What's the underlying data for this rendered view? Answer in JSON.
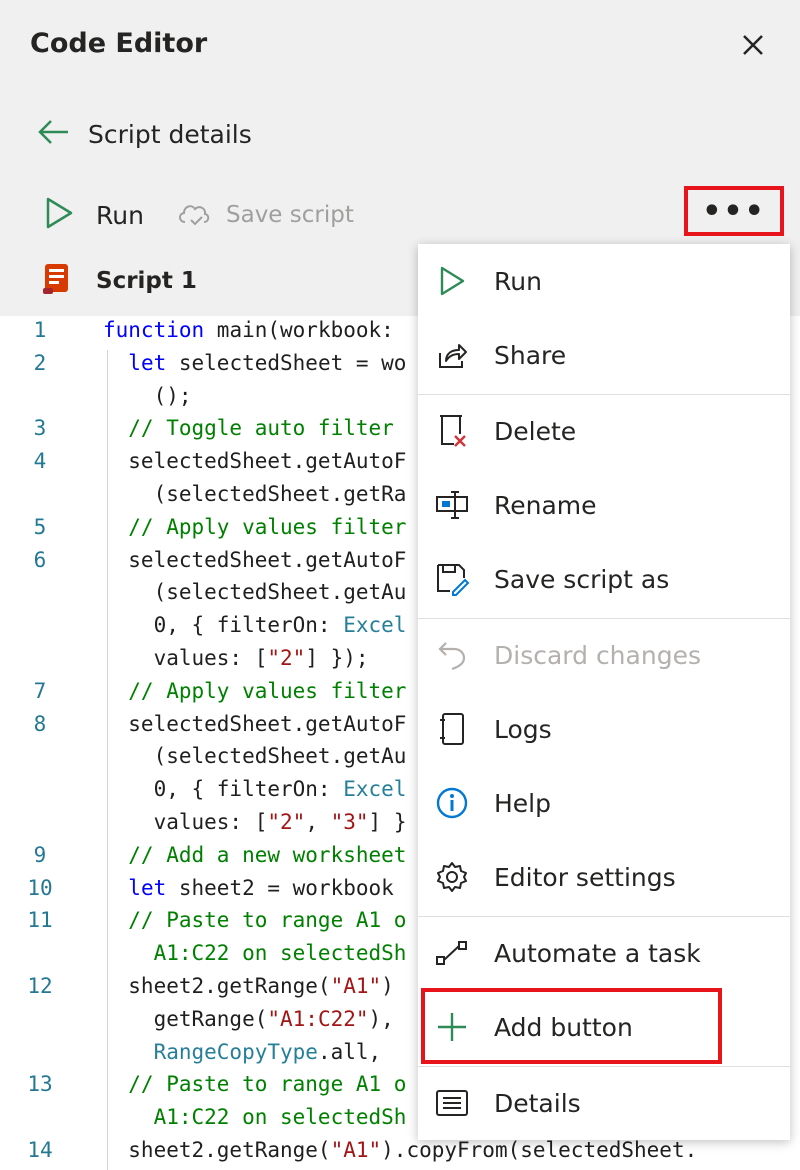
{
  "panel": {
    "title": "Code Editor"
  },
  "nav": {
    "back_label": "Script details"
  },
  "toolbar": {
    "run_label": "Run",
    "save_label": "Save script",
    "more_label": "•••"
  },
  "script": {
    "name": "Script 1"
  },
  "code_lines": [
    {
      "num": "1",
      "segments": [
        {
          "t": "function",
          "c": "kw"
        },
        {
          "t": " main(workbook:",
          "c": ""
        }
      ]
    },
    {
      "num": "2",
      "segments": [
        {
          "t": "  ",
          "c": ""
        },
        {
          "t": "let",
          "c": "kw"
        },
        {
          "t": " selectedSheet = wo",
          "c": ""
        }
      ]
    },
    {
      "num": "",
      "segments": [
        {
          "t": "    ();",
          "c": ""
        }
      ]
    },
    {
      "num": "3",
      "segments": [
        {
          "t": "  // Toggle auto filter",
          "c": "cm"
        }
      ]
    },
    {
      "num": "4",
      "segments": [
        {
          "t": "  selectedSheet.getAutoF",
          "c": ""
        }
      ]
    },
    {
      "num": "",
      "segments": [
        {
          "t": "    (selectedSheet.getRa",
          "c": ""
        }
      ]
    },
    {
      "num": "5",
      "segments": [
        {
          "t": "  // Apply values filter",
          "c": "cm"
        }
      ]
    },
    {
      "num": "6",
      "segments": [
        {
          "t": "  selectedSheet.getAutoF",
          "c": ""
        }
      ]
    },
    {
      "num": "",
      "segments": [
        {
          "t": "    (selectedSheet.getAu",
          "c": ""
        }
      ]
    },
    {
      "num": "",
      "segments": [
        {
          "t": "    0, { filterOn: ",
          "c": ""
        },
        {
          "t": "Excel",
          "c": "ty"
        }
      ]
    },
    {
      "num": "",
      "segments": [
        {
          "t": "    values: [",
          "c": ""
        },
        {
          "t": "\"2\"",
          "c": "st"
        },
        {
          "t": "] });",
          "c": ""
        }
      ]
    },
    {
      "num": "7",
      "segments": [
        {
          "t": "  // Apply values filter",
          "c": "cm"
        }
      ]
    },
    {
      "num": "8",
      "segments": [
        {
          "t": "  selectedSheet.getAutoF",
          "c": ""
        }
      ]
    },
    {
      "num": "",
      "segments": [
        {
          "t": "    (selectedSheet.getAu",
          "c": ""
        }
      ]
    },
    {
      "num": "",
      "segments": [
        {
          "t": "    0, { filterOn: ",
          "c": ""
        },
        {
          "t": "Excel",
          "c": "ty"
        }
      ]
    },
    {
      "num": "",
      "segments": [
        {
          "t": "    values: [",
          "c": ""
        },
        {
          "t": "\"2\"",
          "c": "st"
        },
        {
          "t": ", ",
          "c": ""
        },
        {
          "t": "\"3\"",
          "c": "st"
        },
        {
          "t": "] }",
          "c": ""
        }
      ]
    },
    {
      "num": "9",
      "segments": [
        {
          "t": "  // Add a new worksheet",
          "c": "cm"
        }
      ]
    },
    {
      "num": "10",
      "segments": [
        {
          "t": "  ",
          "c": ""
        },
        {
          "t": "let",
          "c": "kw"
        },
        {
          "t": " sheet2 = workbook",
          "c": ""
        }
      ]
    },
    {
      "num": "11",
      "segments": [
        {
          "t": "  // Paste to range A1 o",
          "c": "cm"
        }
      ]
    },
    {
      "num": "",
      "segments": [
        {
          "t": "    A1:C22 on selectedSh",
          "c": "cm"
        }
      ]
    },
    {
      "num": "12",
      "segments": [
        {
          "t": "  sheet2.getRange(",
          "c": ""
        },
        {
          "t": "\"A1\"",
          "c": "st"
        },
        {
          "t": ")",
          "c": ""
        }
      ]
    },
    {
      "num": "",
      "segments": [
        {
          "t": "    getRange(",
          "c": ""
        },
        {
          "t": "\"A1:C22\"",
          "c": "st"
        },
        {
          "t": "),",
          "c": ""
        }
      ]
    },
    {
      "num": "",
      "segments": [
        {
          "t": "    ",
          "c": ""
        },
        {
          "t": "RangeCopyType",
          "c": "ty"
        },
        {
          "t": ".all, ",
          "c": ""
        }
      ]
    },
    {
      "num": "13",
      "segments": [
        {
          "t": "  // Paste to range A1 o",
          "c": "cm"
        }
      ]
    },
    {
      "num": "",
      "segments": [
        {
          "t": "    A1:C22 on selectedSh",
          "c": "cm"
        }
      ]
    },
    {
      "num": "14",
      "segments": [
        {
          "t": "  sheet2.getRange(",
          "c": ""
        },
        {
          "t": "\"A1\"",
          "c": "st"
        },
        {
          "t": ").copyFrom(selectedSheet.",
          "c": ""
        }
      ]
    }
  ],
  "menu": {
    "items": [
      {
        "id": "run",
        "label": "Run",
        "icon": "play-icon",
        "disabled": false
      },
      {
        "id": "share",
        "label": "Share",
        "icon": "share-icon",
        "disabled": false
      },
      {
        "id": "delete",
        "label": "Delete",
        "icon": "delete-icon",
        "disabled": false
      },
      {
        "id": "rename",
        "label": "Rename",
        "icon": "rename-icon",
        "disabled": false
      },
      {
        "id": "save-as",
        "label": "Save script as",
        "icon": "save-as-icon",
        "disabled": false
      },
      {
        "id": "discard",
        "label": "Discard changes",
        "icon": "undo-icon",
        "disabled": true
      },
      {
        "id": "logs",
        "label": "Logs",
        "icon": "logs-icon",
        "disabled": false
      },
      {
        "id": "help",
        "label": "Help",
        "icon": "info-icon",
        "disabled": false
      },
      {
        "id": "editor-settings",
        "label": "Editor settings",
        "icon": "gear-icon",
        "disabled": false
      },
      {
        "id": "automate",
        "label": "Automate a task",
        "icon": "flow-icon",
        "disabled": false
      },
      {
        "id": "add-button",
        "label": "Add button",
        "icon": "plus-icon",
        "disabled": false
      },
      {
        "id": "details",
        "label": "Details",
        "icon": "details-icon",
        "disabled": false
      }
    ]
  },
  "colors": {
    "accent_green": "#2e8b57",
    "highlight_red": "#e8141c",
    "line_number": "#237893"
  }
}
